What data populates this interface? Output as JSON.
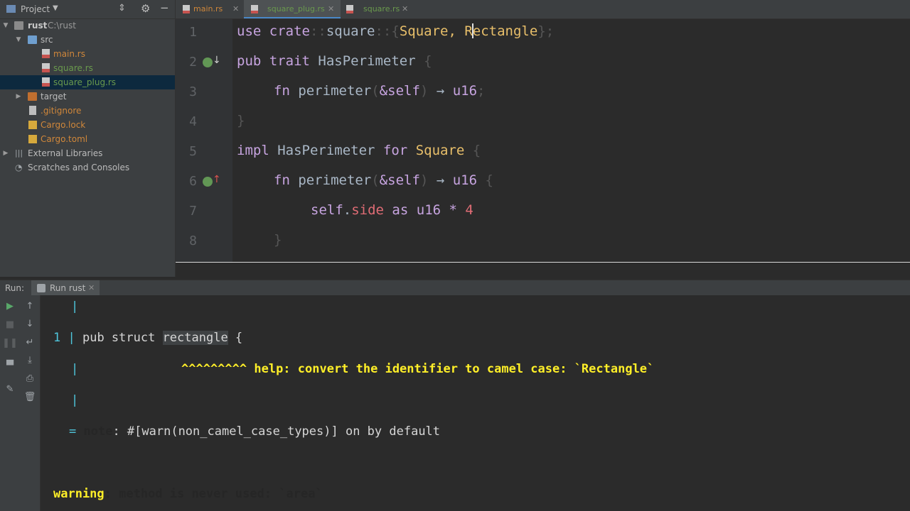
{
  "project_panel": {
    "title": "Project",
    "tree": [
      {
        "name": "rust",
        "detail": "C:\\rust"
      },
      {
        "name": "src"
      },
      {
        "name": "main.rs"
      },
      {
        "name": "square.rs"
      },
      {
        "name": "square_plug.rs"
      },
      {
        "name": "target"
      },
      {
        "name": ".gitignore"
      },
      {
        "name": "Cargo.lock"
      },
      {
        "name": "Cargo.toml"
      },
      {
        "name": "External Libraries"
      },
      {
        "name": "Scratches and Consoles"
      }
    ]
  },
  "tabs": [
    {
      "label": "main.rs"
    },
    {
      "label": "square_plug.rs"
    },
    {
      "label": "square.rs"
    }
  ],
  "editor": {
    "line_numbers": [
      "1",
      "2",
      "3",
      "4",
      "5",
      "6",
      "7",
      "8"
    ],
    "lines": {
      "l1": {
        "a": "use crate",
        "b": "::",
        "c": "square",
        "d": "::",
        "e": "{",
        "f": "Square, ",
        "g": "R",
        "h": "ectangle",
        "i": "};"
      },
      "l2": {
        "a": "pub trait ",
        "b": "HasPerimeter",
        "c": " {"
      },
      "l3": {
        "a": "fn ",
        "b": "perimeter",
        "c": "(",
        "d": "&self",
        "e": ") ",
        "f": "→",
        "g": " u16",
        "h": ";"
      },
      "l4": {
        "a": "}"
      },
      "l5": {
        "a": "impl ",
        "b": "HasPerimeter",
        "c": " for ",
        "d": "Square",
        "e": " {"
      },
      "l6": {
        "a": "fn ",
        "b": "perimeter",
        "c": "(",
        "d": "&self",
        "e": ") ",
        "f": "→",
        "g": " u16",
        "h": " {"
      },
      "l7": {
        "a": "self",
        "b": ".",
        "c": "side",
        "d": " as ",
        "e": "u16",
        "f": " * ",
        "g": "4"
      },
      "l8": {
        "a": "}"
      }
    }
  },
  "run": {
    "label": "Run:",
    "tab": "Run rust",
    "console": {
      "pipe": "|",
      "c2_num": "1",
      "c2_pipe": " | ",
      "c2_code": "pub struct ",
      "c2_id": "rectangle",
      "c2_end": " {",
      "c3_carets": "^^^^^^^^^",
      "c3_help": " help: convert the identifier to camel case: `Rectangle`",
      "c5_eq": "=",
      "c5_note": "note",
      "c5_rest": ": #[warn(non_camel_case_types)] on by default",
      "c6_warn": "warning",
      "c6_rest": ": method is never used: `area`"
    }
  },
  "colors": {
    "accent": "#4a88c7",
    "selection": "#0d293e",
    "warning": "#ffef28",
    "console_cyan": "#4fc6dc"
  }
}
